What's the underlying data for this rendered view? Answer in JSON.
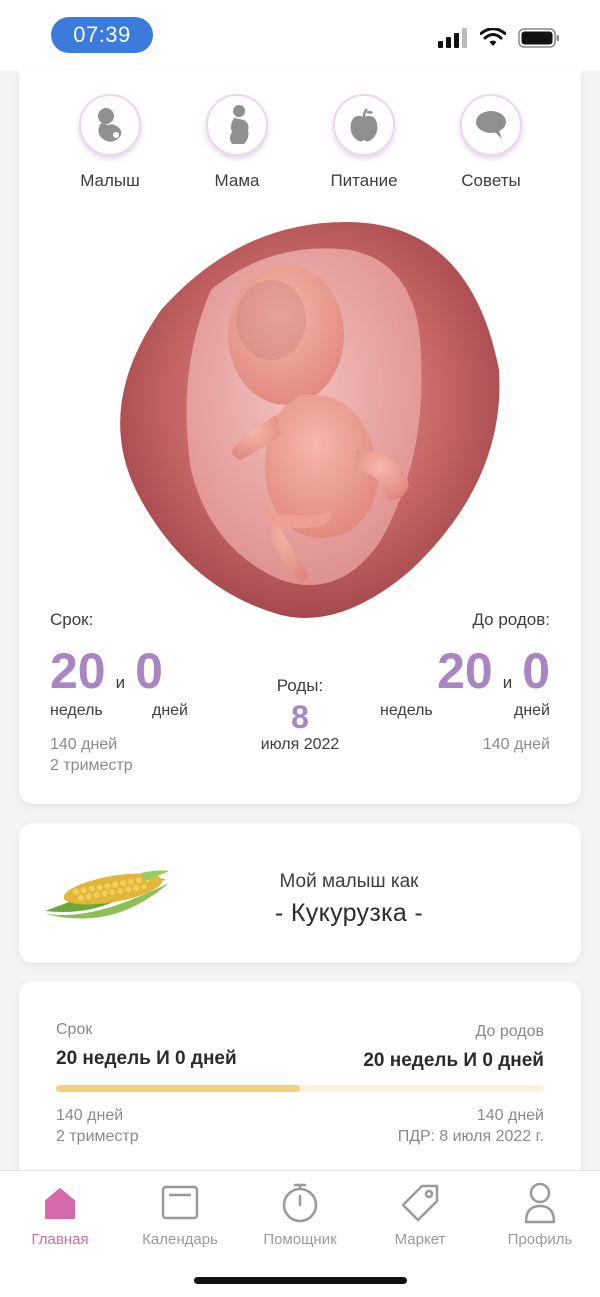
{
  "status_bar": {
    "time": "07:39"
  },
  "categories": [
    {
      "label": "Малыш",
      "icon": "baby-icon"
    },
    {
      "label": "Мама",
      "icon": "mother-icon"
    },
    {
      "label": "Питание",
      "icon": "apple-icon"
    },
    {
      "label": "Советы",
      "icon": "speech-bubble-icon"
    }
  ],
  "term": {
    "caption": "Срок:",
    "weeks": "20",
    "and": "и",
    "days": "0",
    "weeks_unit": "недель",
    "days_unit": "дней",
    "total_days": "140 дней",
    "trimester": "2 триместр"
  },
  "birth": {
    "label": "Роды:",
    "day": "8",
    "month_year": "июля 2022"
  },
  "until_birth": {
    "caption": "До родов:",
    "weeks": "20",
    "and": "и",
    "days": "0",
    "weeks_unit": "недель",
    "days_unit": "дней",
    "total_days": "140 дней"
  },
  "compare": {
    "line1": "Мой малыш как",
    "line2": "- Кукурузка -"
  },
  "progress": {
    "left_caption": "Срок",
    "left_value": "20 недель И 0 дней",
    "right_caption": "До родов",
    "right_value": "20 недель И 0 дней",
    "fraction": 0.5,
    "left_sub1": "140 дней",
    "left_sub2": "2 триместр",
    "right_sub1": "140 дней",
    "right_sub2": "ПДР: 8 июля 2022 г."
  },
  "tabs": [
    {
      "label": "Главная",
      "icon": "home-icon",
      "active": true
    },
    {
      "label": "Календарь",
      "icon": "calendar-icon",
      "active": false
    },
    {
      "label": "Помощник",
      "icon": "stopwatch-icon",
      "active": false
    },
    {
      "label": "Маркет",
      "icon": "tag-icon",
      "active": false
    },
    {
      "label": "Профиль",
      "icon": "profile-icon",
      "active": false
    }
  ],
  "colors": {
    "accent": "#a985c4",
    "tab_active": "#d46aa8",
    "progress_fill": "#f2d27a",
    "time_pill": "#3a7bdc"
  }
}
